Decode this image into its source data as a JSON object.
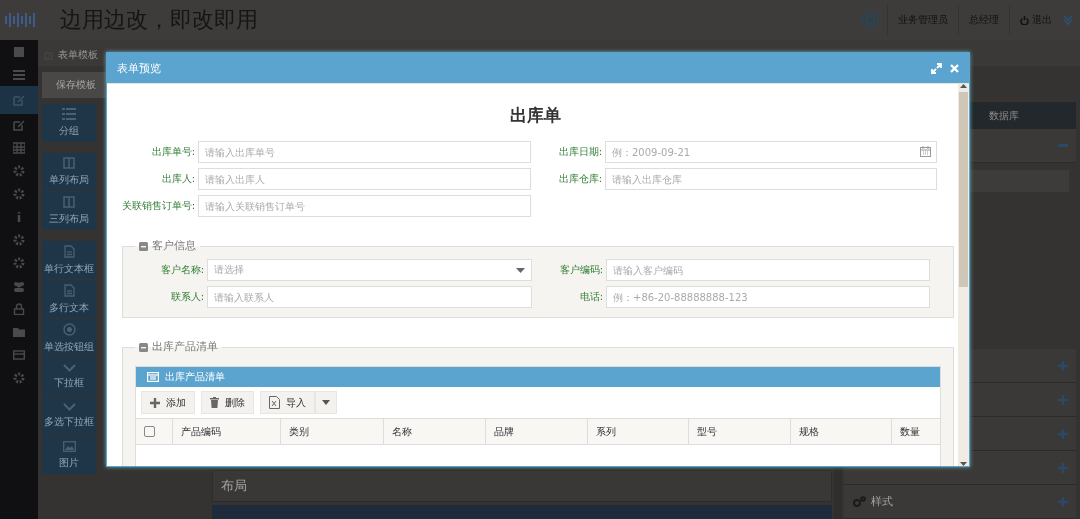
{
  "app": {
    "title": "边用边改，即改即用",
    "user_items": [
      "业务管理员",
      "总经理"
    ],
    "logout": "退出"
  },
  "toolbar": {
    "tab": "表单模板",
    "save_button": "保存模板"
  },
  "palette": [
    {
      "label": "分组"
    },
    {
      "label": "单列布局"
    },
    {
      "label": "三列布局"
    },
    {
      "label": "单行文本框"
    },
    {
      "label": "多行文本"
    },
    {
      "label": "单选按钮组"
    },
    {
      "label": "下拉框"
    },
    {
      "label": "多选下拉框"
    },
    {
      "label": "图片"
    }
  ],
  "canvas": {
    "label": "布局"
  },
  "properties": {
    "header": "数据库",
    "style_section": "样式"
  },
  "dialog": {
    "title": "表单预览",
    "form_title": "出库单",
    "fields": [
      {
        "label": "出库单号:",
        "placeholder": "请输入出库单号",
        "kind": "text"
      },
      {
        "label": "出库日期:",
        "placeholder": "例：2009-09-21",
        "kind": "date"
      },
      {
        "label": "出库人:",
        "placeholder": "请输入出库人",
        "kind": "text"
      },
      {
        "label": "出库仓库:",
        "placeholder": "请输入出库仓库",
        "kind": "text"
      },
      {
        "label": "关联销售订单号:",
        "placeholder": "请输入关联销售订单号",
        "kind": "text"
      }
    ],
    "customer_section": {
      "legend": "客户信息",
      "fields": [
        {
          "label": "客户名称:",
          "placeholder": "请选择",
          "kind": "select"
        },
        {
          "label": "客户编码:",
          "placeholder": "请输入客户编码",
          "kind": "text"
        },
        {
          "label": "联系人:",
          "placeholder": "请输入联系人",
          "kind": "text"
        },
        {
          "label": "电话:",
          "placeholder": "例：+86-20-88888888-123",
          "kind": "text"
        }
      ]
    },
    "product_section": {
      "legend": "出库产品清单",
      "grid_title": "出库产品清单",
      "buttons": [
        "添加",
        "删除",
        "导入"
      ],
      "columns": [
        "产品编码",
        "类别",
        "名称",
        "品牌",
        "系列",
        "型号",
        "规格",
        "数量"
      ],
      "select_all_checked": false
    }
  }
}
